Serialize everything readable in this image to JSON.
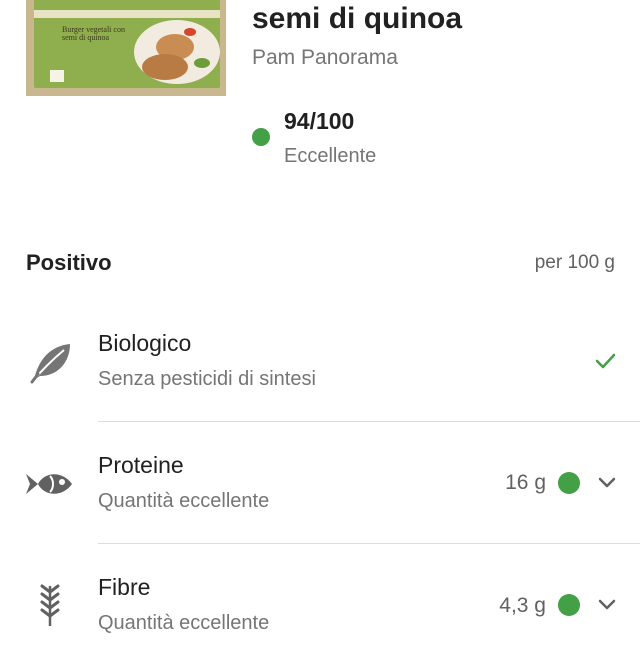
{
  "product": {
    "name": "semi di quinoa",
    "brand": "Pam Panorama",
    "image_text": "Burger vegetali con semi di quinoa",
    "score": "94/100",
    "score_label": "Eccellente",
    "score_color": "#43a047"
  },
  "section": {
    "title": "Positivo",
    "unit": "per 100 g"
  },
  "items": [
    {
      "title": "Biologico",
      "subtitle": "Senza pesticidi di sintesi",
      "icon": "leaf-icon",
      "status": "check-icon"
    },
    {
      "title": "Proteine",
      "subtitle": "Quantità eccellente",
      "value": "16 g",
      "icon": "fish-icon",
      "status": "chevron-down-icon"
    },
    {
      "title": "Fibre",
      "subtitle": "Quantità eccellente",
      "value": "4,3 g",
      "icon": "wheat-icon",
      "status": "chevron-down-icon"
    }
  ],
  "colors": {
    "accent_green": "#43a047",
    "text_primary": "#212121",
    "text_secondary": "#757575",
    "divider": "#dcdcdc"
  }
}
